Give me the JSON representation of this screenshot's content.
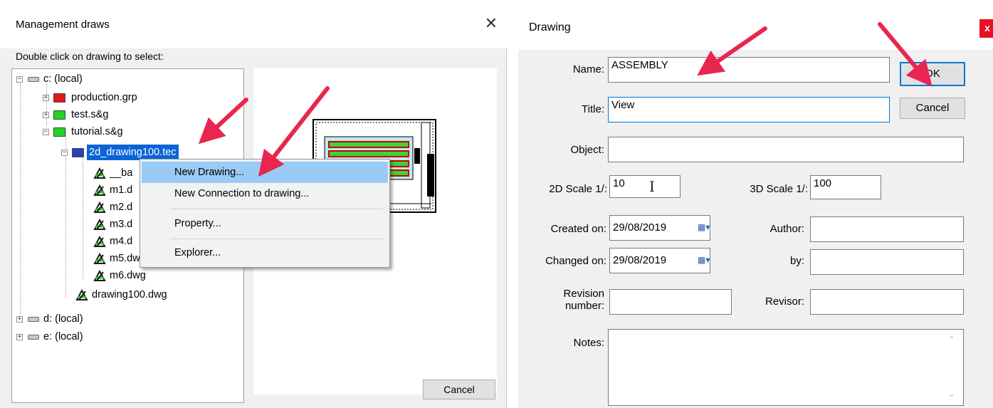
{
  "left_dialog": {
    "title": "Management draws",
    "instruction": "Double click on drawing to select:",
    "cancel_label": "Cancel",
    "tree": [
      {
        "label": "c: (local)",
        "type": "drive"
      },
      {
        "label": "production.grp",
        "type": "folder-red"
      },
      {
        "label": "test.s&g",
        "type": "folder-green"
      },
      {
        "label": "tutorial.s&g",
        "type": "folder-green"
      },
      {
        "label": "2d_drawing100.tec",
        "type": "folder-blue",
        "selected": true
      },
      {
        "label": "__ba",
        "type": "dwg"
      },
      {
        "label": "m1.d",
        "type": "dwg"
      },
      {
        "label": "m2.d",
        "type": "dwg"
      },
      {
        "label": "m3.d",
        "type": "dwg"
      },
      {
        "label": "m4.d",
        "type": "dwg"
      },
      {
        "label": "m5.dwg",
        "type": "dwg"
      },
      {
        "label": "m6.dwg",
        "type": "dwg"
      },
      {
        "label": "drawing100.dwg",
        "type": "dwg"
      },
      {
        "label": "d: (local)",
        "type": "drive"
      },
      {
        "label": "e: (local)",
        "type": "drive"
      }
    ],
    "context_menu": {
      "items": [
        "New Drawing...",
        "New Connection to drawing...",
        "Property...",
        "Explorer..."
      ],
      "highlighted": "New Drawing..."
    }
  },
  "right_dialog": {
    "title": "Drawing",
    "close_glyph": "x",
    "ok_label": "OK",
    "cancel_label": "Cancel",
    "name_label": "Name:",
    "name_value": "ASSEMBLY",
    "title_label": "Title:",
    "title_value": "View",
    "object_label": "Object:",
    "object_value": "",
    "scale2d_label": "2D Scale 1/:",
    "scale2d_value": "10",
    "scale3d_label": "3D Scale 1/:",
    "scale3d_value": "100",
    "created_label": "Created on:",
    "created_value": "29/08/2019",
    "changed_label": "Changed on:",
    "changed_value": "29/08/2019",
    "author_label": "Author:",
    "author_value": "",
    "by_label": "by:",
    "by_value": "",
    "revision_label_1": "Revision",
    "revision_label_2": "number:",
    "revision_value": "",
    "revisor_label": "Revisor:",
    "revisor_value": "",
    "notes_label": "Notes:",
    "notes_value": ""
  },
  "colors": {
    "selection": "#0a64d8",
    "menu_highlight": "#99cbf5",
    "arrow": "#e8264f",
    "close_red": "#e81123"
  }
}
